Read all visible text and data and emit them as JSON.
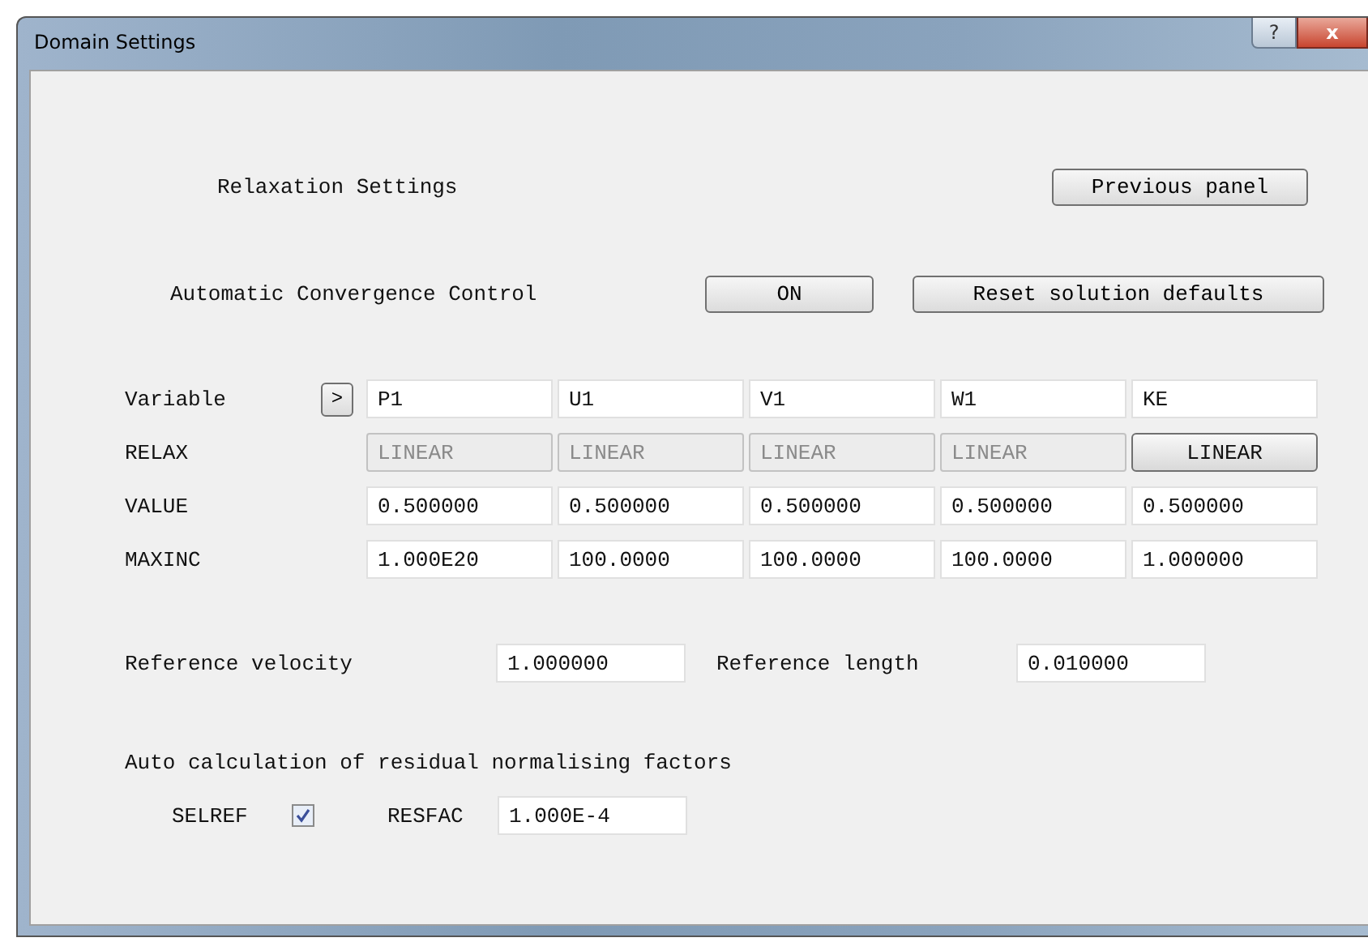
{
  "window": {
    "title": "Domain Settings",
    "help_button": "?",
    "close_button": "x"
  },
  "header": {
    "label": "Relaxation Settings",
    "previous_button": "Previous panel"
  },
  "convergence": {
    "label": "Automatic Convergence Control",
    "toggle": "ON",
    "reset_button": "Reset solution defaults"
  },
  "table": {
    "row_labels": [
      "Variable",
      "RELAX",
      "VALUE",
      "MAXINC"
    ],
    "next_button": ">",
    "columns": [
      {
        "variable": "P1",
        "relax": "LINEAR",
        "relax_disabled": true,
        "value": "0.500000",
        "maxinc": "1.000E20"
      },
      {
        "variable": "U1",
        "relax": "LINEAR",
        "relax_disabled": true,
        "value": "0.500000",
        "maxinc": "100.0000"
      },
      {
        "variable": "V1",
        "relax": "LINEAR",
        "relax_disabled": true,
        "value": "0.500000",
        "maxinc": "100.0000"
      },
      {
        "variable": "W1",
        "relax": "LINEAR",
        "relax_disabled": true,
        "value": "0.500000",
        "maxinc": "100.0000"
      },
      {
        "variable": "KE",
        "relax": "LINEAR",
        "relax_disabled": false,
        "value": "0.500000",
        "maxinc": "1.000000"
      }
    ]
  },
  "reference": {
    "velocity_label": "Reference velocity",
    "velocity": "1.000000",
    "length_label": "Reference length",
    "length": "0.010000"
  },
  "residual": {
    "heading": "Auto calculation of residual normalising factors",
    "selref_label": "SELREF",
    "selref_checked": true,
    "resfac_label": "RESFAC",
    "resfac": "1.000E-4"
  }
}
